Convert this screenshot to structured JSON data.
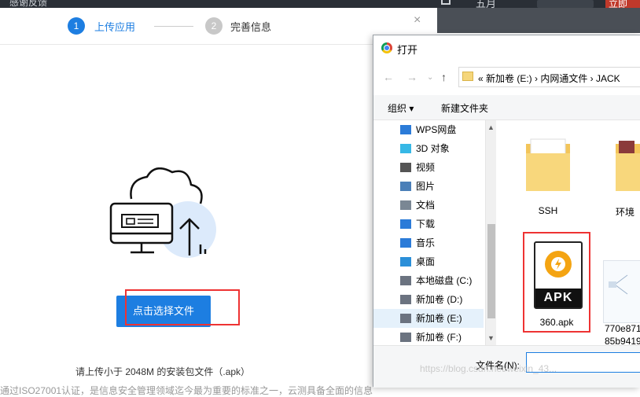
{
  "topbar": {
    "left_text": "感谢反馈",
    "month": "五月",
    "cta": "立即"
  },
  "modal": {
    "step1": {
      "num": "1",
      "label": "上传应用"
    },
    "step2": {
      "num": "2",
      "label": "完善信息"
    },
    "upload_button": "点击选择文件",
    "hint": "请上传小于 2048M 的安装包文件（.apk）",
    "footer_note": "通过ISO27001认证，是信息安全管理领域迄今最为重要的标准之一，云测具备全面的信息"
  },
  "dialog": {
    "title": "打开",
    "address": "«  新加卷 (E:)  ›  内网通文件  ›  JACK",
    "toolbar": {
      "organize": "组织",
      "new_folder": "新建文件夹"
    },
    "nav_items": [
      {
        "label": "WPS网盘",
        "icon": "cloud-icon"
      },
      {
        "label": "3D 对象",
        "icon": "cube-icon"
      },
      {
        "label": "视频",
        "icon": "video-icon"
      },
      {
        "label": "图片",
        "icon": "image-icon"
      },
      {
        "label": "文档",
        "icon": "document-icon"
      },
      {
        "label": "下载",
        "icon": "download-icon"
      },
      {
        "label": "音乐",
        "icon": "music-icon"
      },
      {
        "label": "桌面",
        "icon": "desktop-icon"
      },
      {
        "label": "本地磁盘 (C:)",
        "icon": "drive-icon"
      },
      {
        "label": "新加卷 (D:)",
        "icon": "drive-icon"
      },
      {
        "label": "新加卷 (E:)",
        "icon": "drive-icon",
        "selected": true
      },
      {
        "label": "新加卷 (F:)",
        "icon": "drive-icon"
      }
    ],
    "files": {
      "ssh": "SSH",
      "env": "环境",
      "apk": "360.apk",
      "apk_badge": "APK",
      "thumb_line1": "770e871",
      "thumb_line2": "85b9419"
    },
    "filename_label": "文件名(N):",
    "filename_value": ""
  },
  "watermark": "https://blog.csdn.net/weixin_43..."
}
